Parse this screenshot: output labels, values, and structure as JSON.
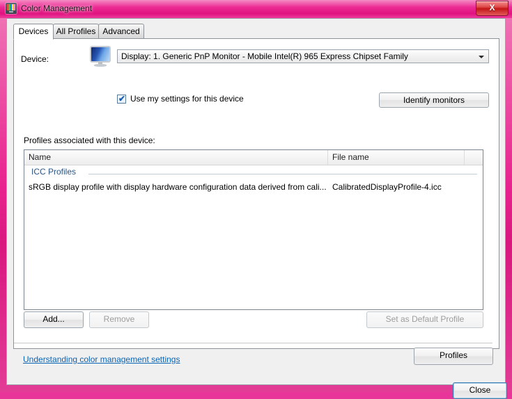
{
  "window": {
    "title": "Color Management",
    "icon": "color-display-icon",
    "close_label": "X",
    "frame_color": "#e8218e"
  },
  "tabs": [
    {
      "id": "devices",
      "label": "Devices",
      "active": true
    },
    {
      "id": "all-profiles",
      "label": "All Profiles",
      "active": false
    },
    {
      "id": "advanced",
      "label": "Advanced",
      "active": false
    }
  ],
  "device": {
    "label": "Device:",
    "icon": "monitor-icon",
    "selected": "Display: 1. Generic PnP Monitor - Mobile Intel(R) 965 Express Chipset Family",
    "use_my_settings_label": "Use my settings for this device",
    "use_my_settings_checked": true,
    "checkmark": "✔",
    "identify_monitors_label": "Identify monitors"
  },
  "profiles": {
    "caption": "Profiles associated with this device:",
    "columns": [
      "Name",
      "File name",
      ""
    ],
    "group_label": "ICC Profiles",
    "rows": [
      {
        "name": "sRGB display profile with display hardware configuration data derived from cali...",
        "file_name": "CalibratedDisplayProfile-4.icc"
      }
    ],
    "buttons": {
      "add": "Add...",
      "remove": "Remove",
      "set_default": "Set as Default Profile"
    }
  },
  "footer": {
    "help_link": "Understanding color management settings",
    "profiles_button": "Profiles",
    "close_button": "Close"
  },
  "colors": {
    "link": "#0a64b4",
    "group_header": "#2b5584",
    "accent": "#e8218e"
  }
}
